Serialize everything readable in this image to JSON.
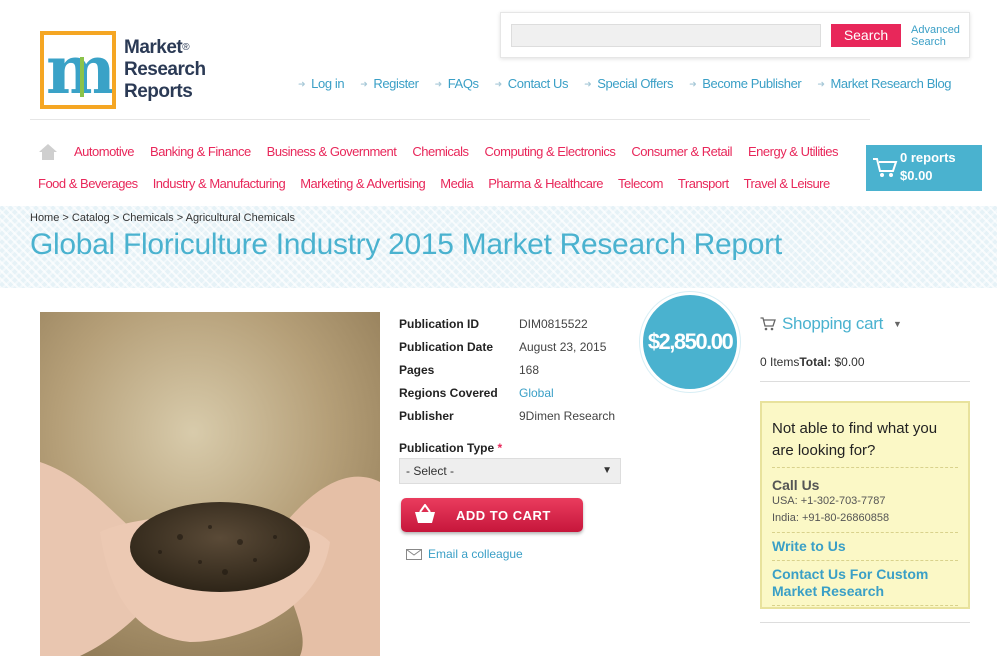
{
  "logo": {
    "line1": "Market",
    "line2": "Research",
    "line3": "Reports",
    "reg": "®"
  },
  "search": {
    "placeholder": "",
    "button": "Search",
    "advanced_line1": "Advanced",
    "advanced_line2": "Search"
  },
  "toplinks": [
    "Log in",
    "Register",
    "FAQs",
    "Contact Us",
    "Special Offers",
    "Become Publisher",
    "Market Research Blog"
  ],
  "categories_row1": [
    "Automotive",
    "Banking & Finance",
    "Business & Government",
    "Chemicals",
    "Computing & Electronics",
    "Consumer & Retail",
    "Energy & Utilities"
  ],
  "categories_row2": [
    "Food & Beverages",
    "Industry & Manufacturing",
    "Marketing & Advertising",
    "Media",
    "Pharma & Healthcare",
    "Telecom",
    "Transport",
    "Travel & Leisure"
  ],
  "cart": {
    "count": "0 reports",
    "total": "$0.00"
  },
  "breadcrumb": "Home > Catalog > Chemicals > Agricultural Chemicals",
  "page_title": "Global Floriculture Industry 2015 Market Research Report",
  "details": [
    {
      "label": "Publication ID",
      "value": "DIM0815522"
    },
    {
      "label": "Publication Date",
      "value": "August 23, 2015"
    },
    {
      "label": "Pages",
      "value": "168"
    },
    {
      "label": "Regions Covered",
      "value": "Global"
    },
    {
      "label": "Publisher",
      "value": "9Dimen Research"
    }
  ],
  "price": "$2,850.00",
  "pub_type": {
    "label": "Publication Type",
    "required": "*",
    "selected": "- Select -"
  },
  "add_to_cart": "ADD TO CART",
  "email_colleague": "Email a colleague",
  "shopping_cart": {
    "title": "Shopping cart",
    "items": "0 Items",
    "total_label": "Total:",
    "total": "$0.00"
  },
  "help": {
    "question": "Not able to find what you are looking for?",
    "call_us": "Call Us",
    "usa": "USA: +1-302-703-7787",
    "india": "India: +91-80-26860858",
    "write": "Write to Us",
    "custom": "Contact Us For Custom Market Research"
  },
  "colors": {
    "accent_blue": "#4ab2cf",
    "accent_pink": "#e8275a",
    "help_bg": "#fbf8c6"
  }
}
